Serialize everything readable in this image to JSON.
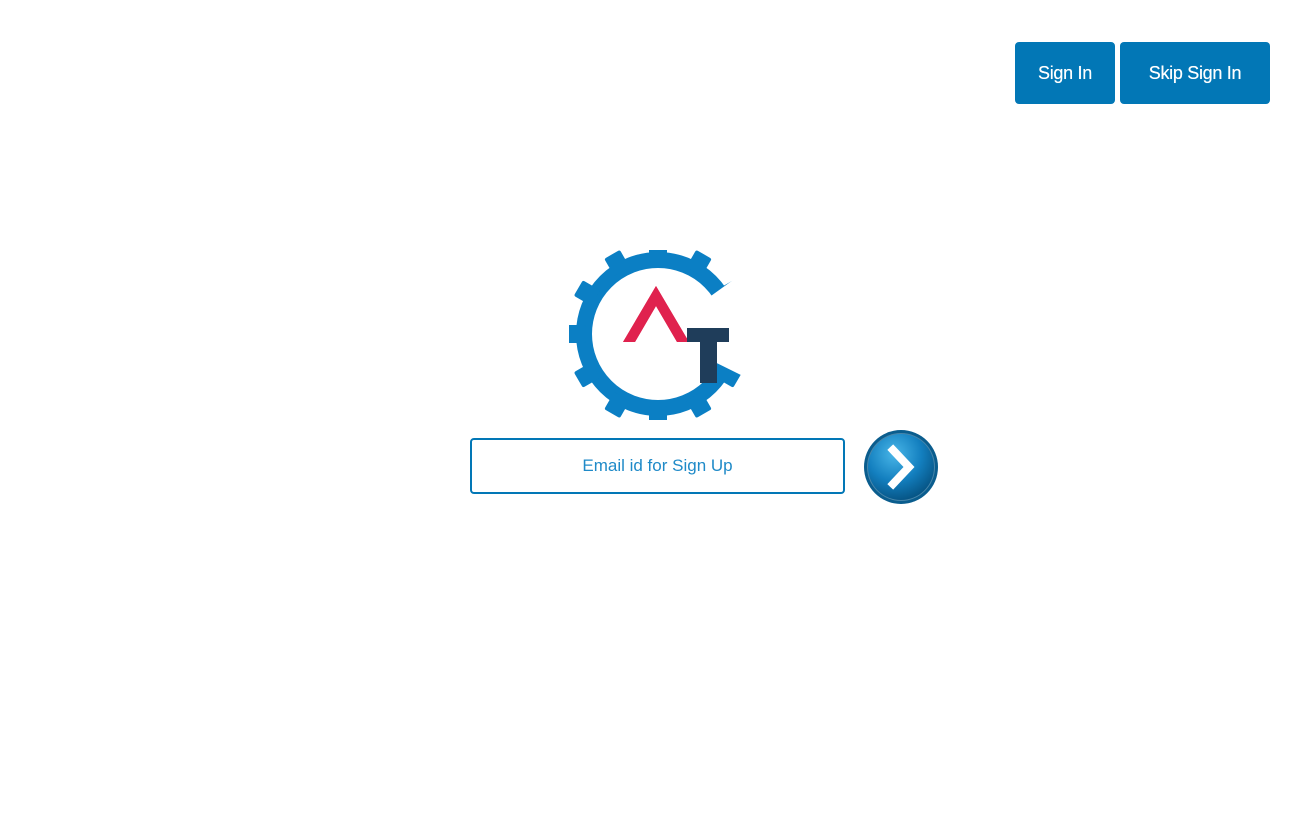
{
  "header": {
    "sign_in_label": "Sign In",
    "skip_sign_in_label": "Skip Sign In"
  },
  "logo": {
    "name": "logo-icon",
    "colors": {
      "gear": "#0b7fc4",
      "triangle": "#e0224e",
      "t_letter": "#1f3d5a"
    }
  },
  "signup": {
    "email_placeholder": "Email id for Sign Up",
    "email_value": "",
    "submit_icon": "chevron-right-icon"
  },
  "colors": {
    "accent": "#0277b6",
    "placeholder": "#1f8ac8",
    "background": "#ffffff"
  }
}
